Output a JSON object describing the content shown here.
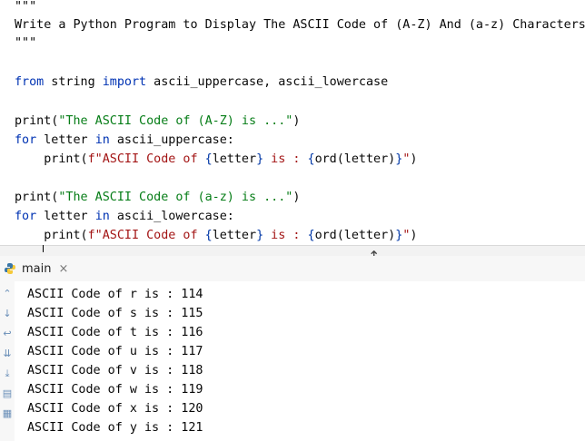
{
  "editor": {
    "doc_open": "\"\"\"",
    "doc_text": "Write a Python Program to Display The ASCII Code of (A-Z) And (a-z) Characters",
    "doc_close": "\"\"\"",
    "import_line": {
      "k_from": "from",
      "module": " string ",
      "k_import": "import",
      "names": " ascii_uppercase, ascii_lowercase"
    },
    "print1": {
      "fn": "print(",
      "str": "\"The ASCII Code of (A-Z) is ...\"",
      "close": ")"
    },
    "for1": {
      "k_for": "for",
      "var": " letter ",
      "k_in": "in",
      "iter": " ascii_uppercase:"
    },
    "print2": {
      "indent": "    ",
      "fn": "print(",
      "fpre": "f\"ASCII Code of ",
      "b1": "{",
      "v1": "letter",
      "b2": "}",
      "mid": " is : ",
      "b3": "{",
      "v2": "ord(letter)",
      "b4": "}",
      "fend": "\"",
      "close": ")"
    },
    "print3": {
      "fn": "print(",
      "str": "\"The ASCII Code of (a-z) is ...\"",
      "close": ")"
    },
    "for2": {
      "k_for": "for",
      "var": " letter ",
      "k_in": "in",
      "iter": " ascii_lowercase:"
    },
    "print4": {
      "indent": "    ",
      "fn": "print(",
      "fpre": "f\"ASCII Code of ",
      "b1": "{",
      "v1": "letter",
      "b2": "}",
      "mid": " is : ",
      "b3": "{",
      "v2": "ord(letter)",
      "b4": "}",
      "fend": "\"",
      "close": ")"
    }
  },
  "run_panel": {
    "tab_label": "main",
    "close_glyph": "×",
    "python_icon": "python-icon",
    "output": [
      "ASCII Code of r is : 114",
      "ASCII Code of s is : 115",
      "ASCII Code of t is : 116",
      "ASCII Code of u is : 117",
      "ASCII Code of v is : 118",
      "ASCII Code of w is : 119",
      "ASCII Code of x is : 120",
      "ASCII Code of y is : 121"
    ]
  },
  "colors": {
    "keyword": "#0033b3",
    "string": "#067d17",
    "brace": "#0037a6",
    "background": "#ffffff"
  }
}
